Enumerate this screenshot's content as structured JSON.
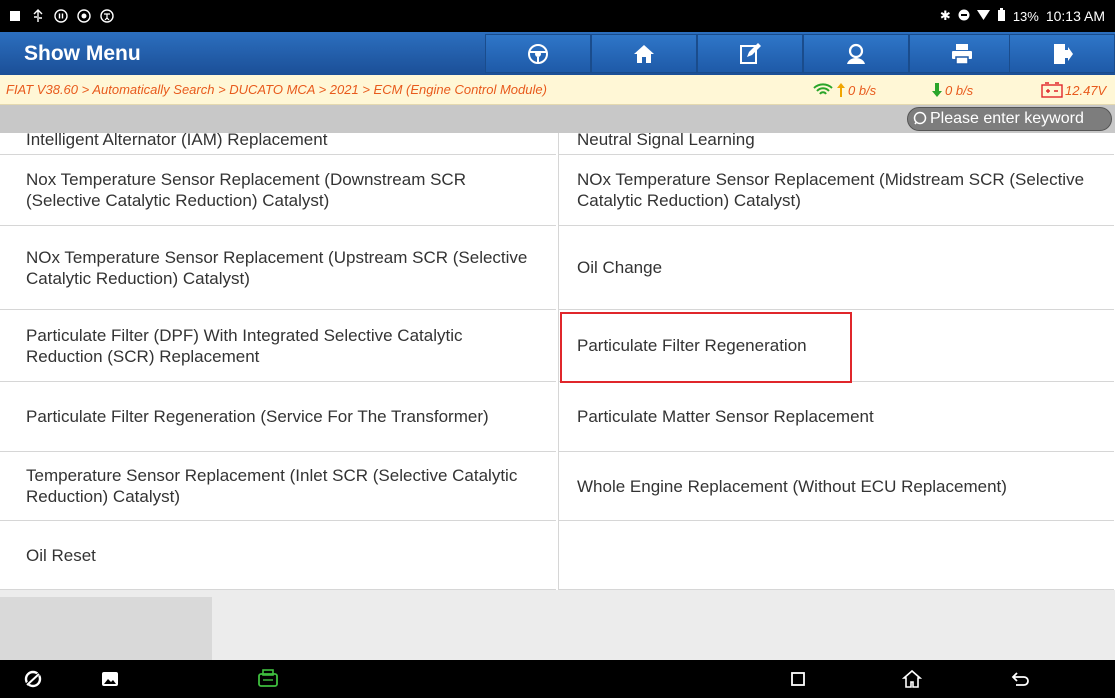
{
  "statusbar": {
    "battery": "13%",
    "time": "10:13 AM"
  },
  "toolbar": {
    "title": "Show Menu",
    "buttons": [
      "steering-wheel-icon",
      "home-icon",
      "edit-icon",
      "user-icon",
      "print-icon",
      "exit-icon"
    ]
  },
  "breadcrumb": {
    "path": "FIAT V38.60 > Automatically Search > DUCATO MCA > 2021 > ECM (Engine Control Module)",
    "upload_rate": "0 b/s",
    "download_rate": "0 b/s",
    "voltage": "12.47V"
  },
  "search": {
    "placeholder": "Please enter keyword"
  },
  "menu": {
    "items": [
      "Intelligent Alternator (IAM) Replacement",
      "Neutral Signal Learning",
      "Nox Temperature Sensor Replacement (Downstream SCR (Selective Catalytic Reduction) Catalyst)",
      "NOx Temperature Sensor Replacement (Midstream SCR (Selective Catalytic Reduction) Catalyst)",
      "NOx Temperature Sensor Replacement (Upstream SCR (Selective Catalytic Reduction) Catalyst)",
      "Oil Change",
      "Particulate Filter (DPF) With Integrated Selective Catalytic Reduction (SCR) Replacement",
      "Particulate Filter Regeneration",
      "Particulate Filter Regeneration (Service For The Transformer)",
      "Particulate Matter Sensor Replacement",
      "Temperature Sensor Replacement (Inlet SCR (Selective Catalytic Reduction) Catalyst)",
      "Whole Engine Replacement (Without ECU Replacement)",
      "Oil Reset"
    ],
    "highlighted": "Particulate Filter Regeneration"
  },
  "colors": {
    "toolbar": "#1e5aa8",
    "breadcrumb_text": "#e85a1c",
    "upload_arrow": "#f0a500",
    "download_arrow": "#2aa52a",
    "highlight_border": "#e0262b"
  }
}
